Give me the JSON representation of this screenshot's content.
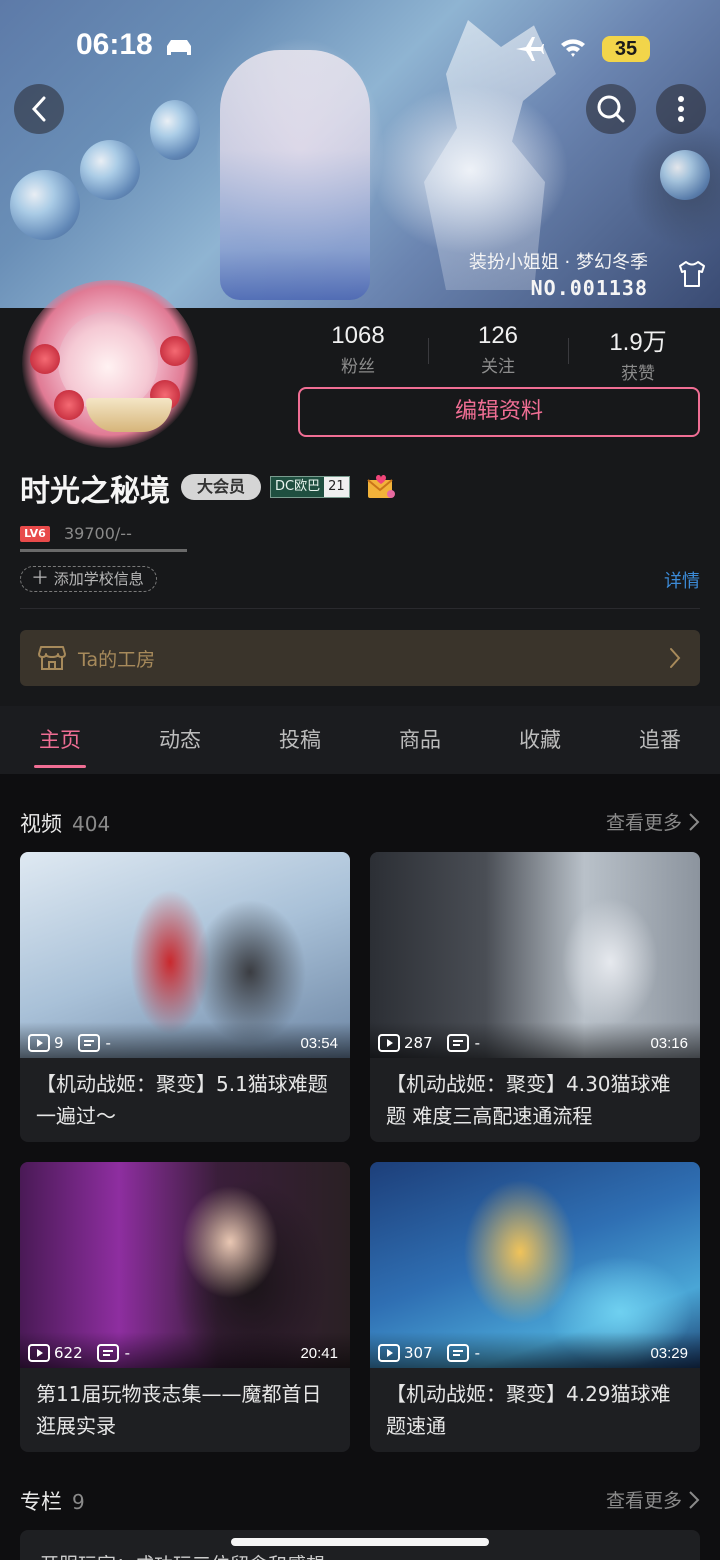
{
  "status_bar": {
    "time": "06:18",
    "battery": "35"
  },
  "banner": {
    "caption_line1": "装扮小姐姐 · 梦幻冬季",
    "caption_line2": "NO.001138"
  },
  "profile": {
    "stats": [
      {
        "value": "1068",
        "label": "粉丝"
      },
      {
        "value": "126",
        "label": "关注"
      },
      {
        "value": "1.9万",
        "label": "获赞"
      }
    ],
    "edit_button": "编辑资料",
    "name": "时光之秘境",
    "vip_badge": "大会员",
    "dc_badge": {
      "left": "DC欧巴",
      "right": "21"
    },
    "level": "LV6",
    "exp": "39700/--",
    "add_school": "添加学校信息",
    "detail_link": "详情",
    "workshop": "Ta的工房"
  },
  "tabs": [
    "主页",
    "动态",
    "投稿",
    "商品",
    "收藏",
    "追番"
  ],
  "active_tab": "主页",
  "videos_section": {
    "title": "视频",
    "count": "404",
    "more": "查看更多"
  },
  "videos": [
    {
      "plays": "9",
      "danmaku": "-",
      "duration": "03:54",
      "title": "【机动战姬：聚变】5.1猫球难题 一遍过～"
    },
    {
      "plays": "287",
      "danmaku": "-",
      "duration": "03:16",
      "title": "【机动战姬：聚变】4.30猫球难题 难度三高配速通流程"
    },
    {
      "plays": "622",
      "danmaku": "-",
      "duration": "20:41",
      "title": "第11届玩物丧志集——魔都首日逛展实录"
    },
    {
      "plays": "307",
      "danmaku": "-",
      "duration": "03:29",
      "title": "【机动战姬：聚变】4.29猫球难题速通"
    }
  ],
  "columns_section": {
    "title": "专栏",
    "count": "9",
    "more": "查看更多"
  },
  "column_preview": "开服玩家：成功玩三位留念和感想"
}
